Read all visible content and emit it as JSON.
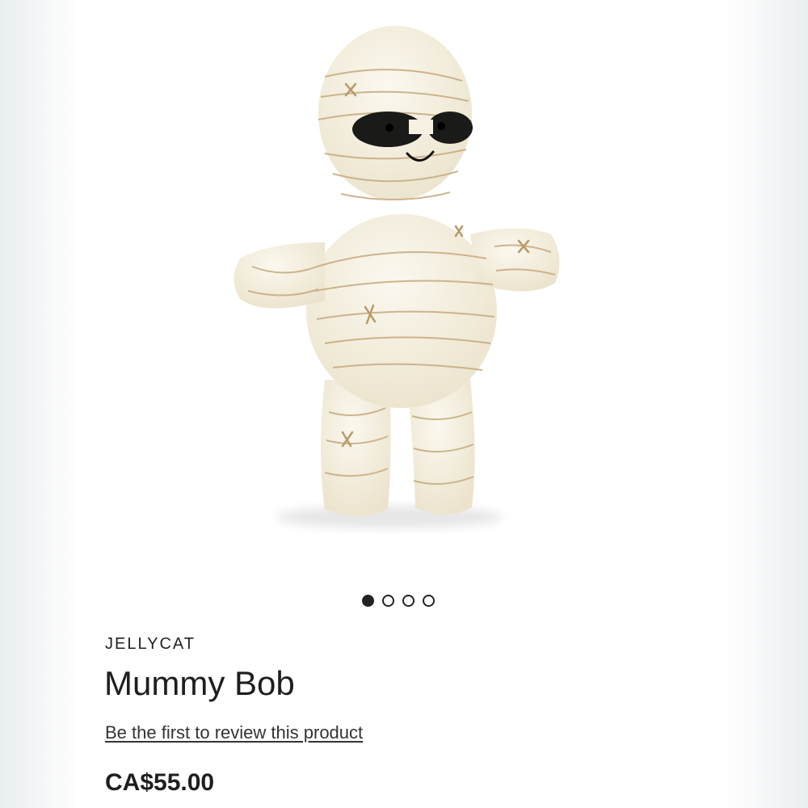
{
  "product": {
    "brand": "JELLYCAT",
    "name": "Mummy Bob",
    "review_link": "Be the first to review this product",
    "price": "CA$55.00"
  },
  "gallery": {
    "image_subject": "mummy-plush-toy",
    "total_images": 4,
    "active_index": 0
  },
  "colors": {
    "plush": "#f6f1e3",
    "stitch": "#c8ad84",
    "text": "#1e1e1e"
  }
}
